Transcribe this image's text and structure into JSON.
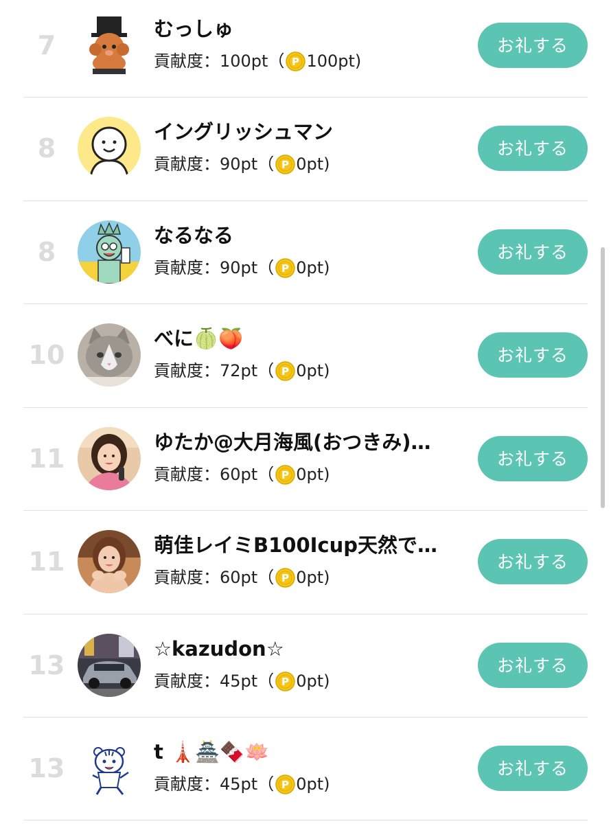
{
  "contribution_label": "貢献度：",
  "thanks_label": "お礼する",
  "rankings": [
    {
      "rank": "7",
      "name": "むっしゅ",
      "points": "100pt",
      "coin": "100pt",
      "avatar": "poodle-tophat-avatar"
    },
    {
      "rank": "8",
      "name": "イングリッシュマン",
      "points": "90pt",
      "coin": "0pt",
      "avatar": "default-face-avatar"
    },
    {
      "rank": "8",
      "name": "なるなる",
      "points": "90pt",
      "coin": "0pt",
      "avatar": "statue-character-avatar"
    },
    {
      "rank": "10",
      "name": "べに🍈🍑",
      "points": "72pt",
      "coin": "0pt",
      "avatar": "cat-photo-avatar"
    },
    {
      "rank": "11",
      "name": "ゆたか@大月海風(おつきみ)…",
      "points": "60pt",
      "coin": "0pt",
      "avatar": "person-photo-avatar"
    },
    {
      "rank": "11",
      "name": "萌佳レイミB100Icup天然で…",
      "points": "60pt",
      "coin": "0pt",
      "avatar": "person-photo-avatar"
    },
    {
      "rank": "13",
      "name": "☆kazudon☆",
      "points": "45pt",
      "coin": "0pt",
      "avatar": "car-photo-avatar"
    },
    {
      "rank": "13",
      "name": "t 🗼🏯🍫🪷",
      "points": "45pt",
      "coin": "0pt",
      "avatar": "tiger-mascot-avatar"
    }
  ],
  "colors": {
    "accent": "#5cc4b3",
    "rank": "#dcdcdc",
    "coin": "#f5c518",
    "divider": "#e0e0e0"
  }
}
